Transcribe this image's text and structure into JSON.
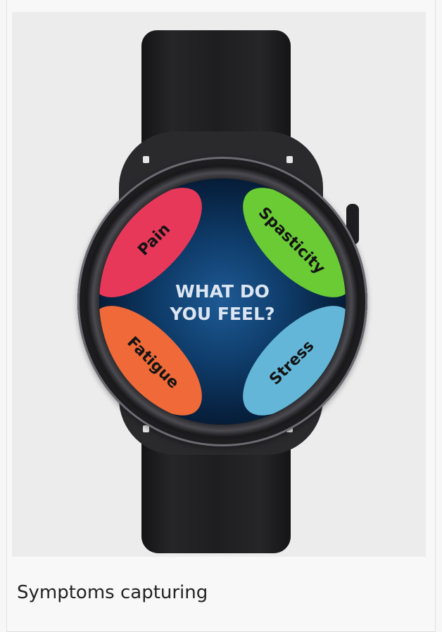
{
  "screen": {
    "prompt_line1": "WHAT DO",
    "prompt_line2": "YOU FEEL?",
    "options": [
      {
        "label": "Pain",
        "color": "#e8385a"
      },
      {
        "label": "Spasticity",
        "color": "#6acb35"
      },
      {
        "label": "Fatigue",
        "color": "#ef6a38"
      },
      {
        "label": "Stress",
        "color": "#63b6d8"
      }
    ]
  },
  "caption": "Symptoms capturing"
}
